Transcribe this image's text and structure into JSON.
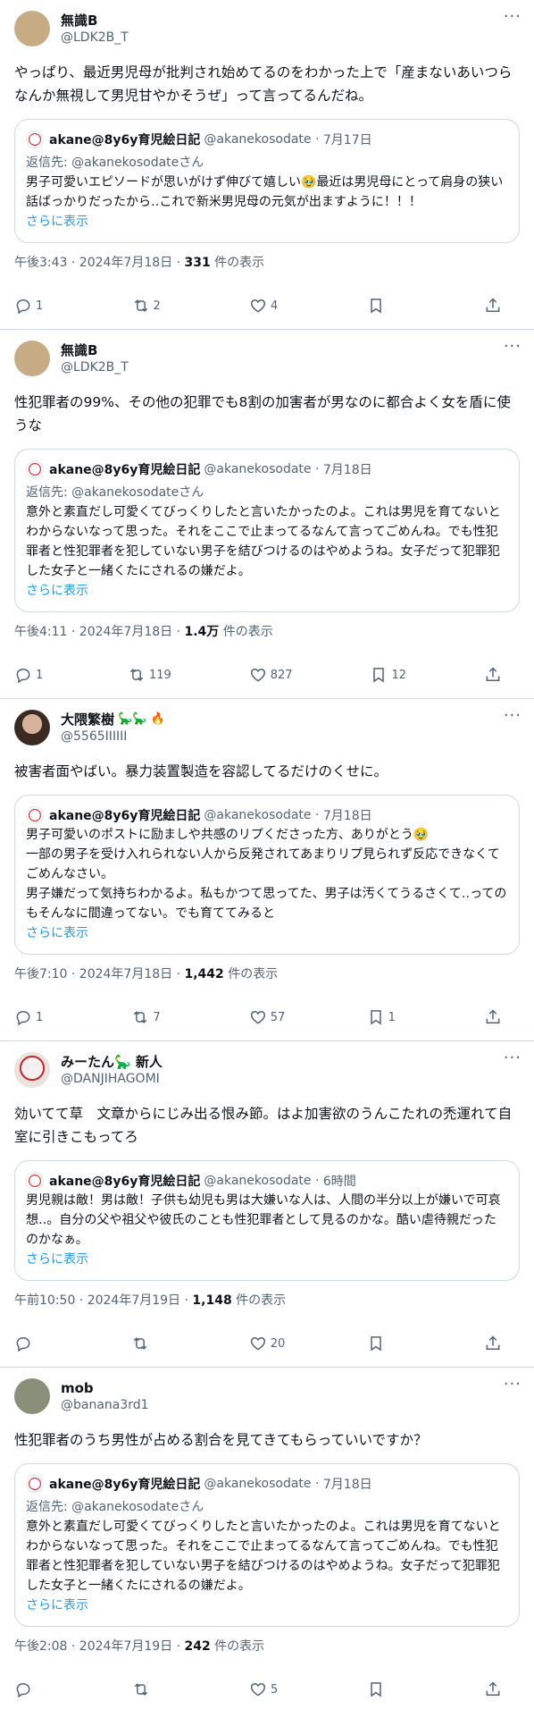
{
  "tweets": [
    {
      "display_name": "無識B",
      "name_deco": "",
      "handle": "@LDK2B_T",
      "avatar": "tan-square",
      "text": "やっぱり、最近男児母が批判され始めてるのをわかった上で「産まないあいつらなんか無視して男児甘やかそうぜ」って言ってるんだね。",
      "quote": {
        "name": "akane@8y6y育児絵日記",
        "handle": "@akanekosodate",
        "date": "7月17日",
        "replying": "返信先: @akanekosodateさん",
        "text": "男子可愛いエピソードが思いがけず伸びて嬉しい🥹最近は男児母にとって肩身の狭い話ばっかりだったから‥これで新米男児母の元気が出ますように！！！",
        "show_more": "さらに表示"
      },
      "time": "午後3:43 · 2024年7月18日 · ",
      "views": "331",
      "views_suffix": " 件の表示",
      "replies": "1",
      "retweets": "2",
      "likes": "4",
      "bookmarks": ""
    },
    {
      "display_name": "無識B",
      "name_deco": "",
      "handle": "@LDK2B_T",
      "avatar": "tan-square",
      "text": "性犯罪者の99%、その他の犯罪でも8割の加害者が男なのに都合よく女を盾に使うな",
      "quote": {
        "name": "akane@8y6y育児絵日記",
        "handle": "@akanekosodate",
        "date": "7月18日",
        "replying": "返信先: @akanekosodateさん",
        "text": "意外と素直だし可愛くてびっくりしたと言いたかったのよ。これは男児を育てないとわからないなって思った。それをここで止まってるなんて言ってごめんね。でも性犯罪者と性犯罪者を犯していない男子を結びつけるのはやめようね。女子だって犯罪犯した女子と一緒くたにされるの嫌だよ。",
        "show_more": "さらに表示"
      },
      "time": "午後4:11 · 2024年7月18日 · ",
      "views": "1.4万",
      "views_suffix": " 件の表示",
      "replies": "1",
      "retweets": "119",
      "likes": "827",
      "bookmarks": "12"
    },
    {
      "display_name": "大隈繁樹",
      "name_deco": "🦕🦕 🔥",
      "handle": "@5565IIIIII",
      "avatar": "face",
      "text": "被害者面やばい。暴力装置製造を容認してるだけのくせに。",
      "quote": {
        "name": "akane@8y6y育児絵日記",
        "handle": "@akanekosodate",
        "date": "7月18日",
        "replying": "",
        "text": "男子可愛いのポストに励ましや共感のリプくださった方、ありがとう🥹\n一部の男子を受け入れられない人から反発されてあまりリプ見られず反応できなくてごめんなさい。\n男子嫌だって気持ちわかるよ。私もかつて思ってた、男子は汚くてうるさくて‥ってのもそんなに間違ってない。でも育ててみると",
        "show_more": "さらに表示"
      },
      "time": "午後7:10 · 2024年7月18日 · ",
      "views": "1,442",
      "views_suffix": " 件の表示",
      "replies": "1",
      "retweets": "7",
      "likes": "57",
      "bookmarks": "1"
    },
    {
      "display_name": "みーたん🦕 新人",
      "name_deco": "",
      "handle": "@DANJIHAGOMI",
      "avatar": "kabuki",
      "text": "効いてて草　文章からにじみ出る恨み節。はよ加害欲のうんこたれの禿運れて自室に引きこもってろ",
      "quote": {
        "name": "akane@8y6y育児絵日記",
        "handle": "@akanekosodate",
        "date": "6時間",
        "replying": "",
        "text": "男児親は敵！男は敵！子供も幼児も男は大嫌いな人は、人間の半分以上が嫌いで可哀想‥。自分の父や祖父や彼氏のことも性犯罪者として見るのかな。酷い虐待親だったのかなぁ。",
        "show_more": "さらに表示"
      },
      "time": "午前10:50 · 2024年7月19日 · ",
      "views": "1,148",
      "views_suffix": " 件の表示",
      "replies": "",
      "retweets": "",
      "likes": "20",
      "bookmarks": ""
    },
    {
      "display_name": "mob",
      "name_deco": "",
      "handle": "@banana3rd1",
      "avatar": "grey",
      "text": "性犯罪者のうち男性が占める割合を見てきてもらっていいですか？",
      "quote": {
        "name": "akane@8y6y育児絵日記",
        "handle": "@akanekosodate",
        "date": "7月18日",
        "replying": "返信先: @akanekosodateさん",
        "text": "意外と素直だし可愛くてびっくりしたと言いたかったのよ。これは男児を育てないとわからないなって思った。それをここで止まってるなんて言ってごめんね。でも性犯罪者と性犯罪者を犯していない男子を結びつけるのはやめようね。女子だって犯罪犯した女子と一緒くたにされるの嫌だよ。",
        "show_more": "さらに表示"
      },
      "time": "午後2:08 · 2024年7月19日 · ",
      "views": "242",
      "views_suffix": " 件の表示",
      "replies": "",
      "retweets": "",
      "likes": "5",
      "bookmarks": ""
    }
  ],
  "icons": {
    "more": "more-icon",
    "reply": "reply-icon",
    "retweet": "retweet-icon",
    "like": "like-icon",
    "bookmark": "bookmark-icon",
    "share": "share-icon"
  },
  "more_glyph": "···",
  "colors": {
    "link": "#1d9bf0",
    "muted": "#536471",
    "border": "#cfd9de"
  }
}
